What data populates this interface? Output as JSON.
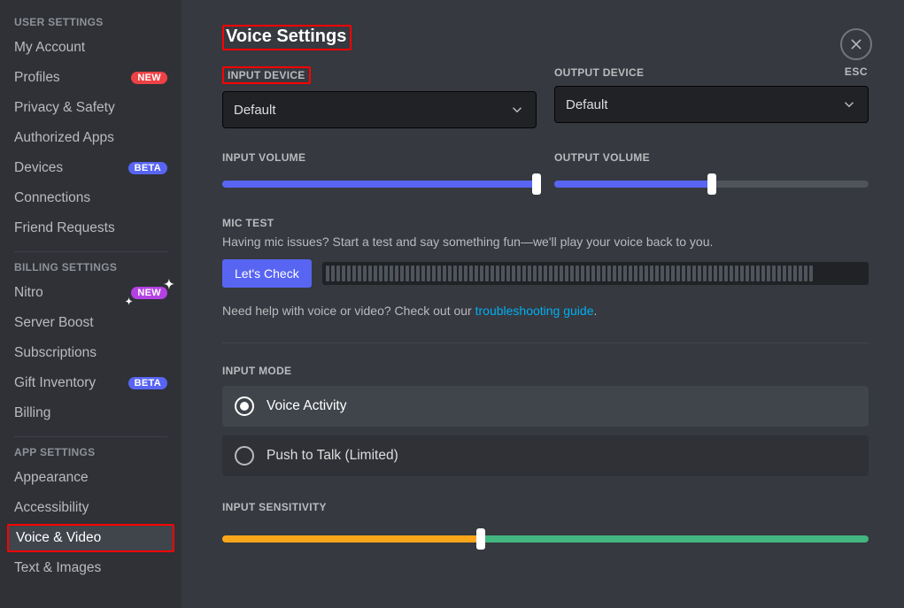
{
  "sidebar": {
    "headers": {
      "user": "USER SETTINGS",
      "billing": "BILLING SETTINGS",
      "app": "APP SETTINGS"
    },
    "user_items": [
      {
        "label": "My Account"
      },
      {
        "label": "Profiles",
        "badge": "NEW",
        "badge_kind": "new"
      },
      {
        "label": "Privacy & Safety"
      },
      {
        "label": "Authorized Apps"
      },
      {
        "label": "Devices",
        "badge": "BETA",
        "badge_kind": "beta"
      },
      {
        "label": "Connections"
      },
      {
        "label": "Friend Requests"
      }
    ],
    "billing_items": [
      {
        "label": "Nitro",
        "badge": "NEW",
        "badge_kind": "nitro"
      },
      {
        "label": "Server Boost"
      },
      {
        "label": "Subscriptions"
      },
      {
        "label": "Gift Inventory",
        "badge": "BETA",
        "badge_kind": "beta"
      },
      {
        "label": "Billing"
      }
    ],
    "app_items": [
      {
        "label": "Appearance"
      },
      {
        "label": "Accessibility"
      },
      {
        "label": "Voice & Video",
        "selected": true,
        "highlight": true
      },
      {
        "label": "Text & Images"
      }
    ]
  },
  "esc": {
    "label": "ESC"
  },
  "page": {
    "title": "Voice Settings",
    "input_device": {
      "label": "INPUT DEVICE",
      "value": "Default"
    },
    "output_device": {
      "label": "OUTPUT DEVICE",
      "value": "Default"
    },
    "input_volume": {
      "label": "INPUT VOLUME",
      "percent": 100
    },
    "output_volume": {
      "label": "OUTPUT VOLUME",
      "percent": 50
    },
    "mic_test": {
      "label": "MIC TEST",
      "desc": "Having mic issues? Start a test and say something fun—we'll play your voice back to you.",
      "button": "Let's Check"
    },
    "help": {
      "prefix": "Need help with voice or video? Check out our ",
      "link": "troubleshooting guide",
      "suffix": "."
    },
    "input_mode": {
      "label": "INPUT MODE",
      "options": [
        {
          "label": "Voice Activity",
          "selected": true
        },
        {
          "label": "Push to Talk (Limited)",
          "selected": false
        }
      ]
    },
    "input_sensitivity": {
      "label": "INPUT SENSITIVITY",
      "percent": 40
    }
  }
}
